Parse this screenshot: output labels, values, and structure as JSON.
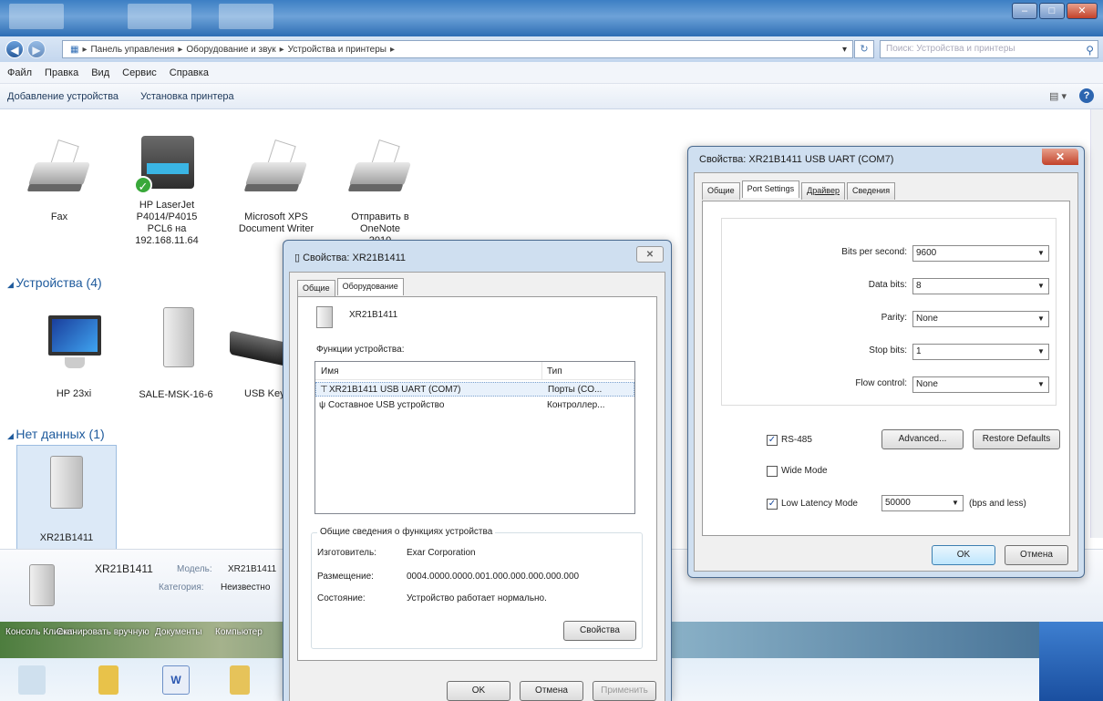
{
  "explorer": {
    "breadcrumbs": [
      "Панель управления",
      "Оборудование и звук",
      "Устройства и принтеры"
    ],
    "search_placeholder": "Поиск: Устройства и принтеры",
    "menu": [
      "Файл",
      "Правка",
      "Вид",
      "Сервис",
      "Справка"
    ],
    "commands": [
      "Добавление устройства",
      "Установка принтера"
    ],
    "printers": [
      {
        "label": "Fax",
        "icon": "fax-icon"
      },
      {
        "label": "HP LaserJet P4014/P4015 PCL6 на 192.168.11.64",
        "icon": "hp-laserjet-printer-icon"
      },
      {
        "label": "Microsoft XPS Document Writer",
        "icon": "xps-printer-icon"
      },
      {
        "label": "Отправить в OneNote 2010",
        "icon": "onenote-printer-icon"
      }
    ],
    "group_devices": "Устройства (4)",
    "devices": [
      {
        "label": "HP 23xi",
        "icon": "monitor-icon"
      },
      {
        "label": "SALE-MSK-16-6",
        "icon": "computer-tower-icon"
      },
      {
        "label": "USB Key",
        "icon": "keyboard-icon"
      }
    ],
    "group_nodata": "Нет данных (1)",
    "nodata_devices": [
      {
        "label": "XR21B1411",
        "icon": "generic-device-icon"
      }
    ],
    "details": {
      "name": "XR21B1411",
      "model_label": "Модель:",
      "model_value": "XR21B1411",
      "category_label": "Категория:",
      "category_value": "Неизвестно"
    },
    "desktop_labels": [
      "Консоль Клиент",
      "Сканировать вручную",
      "Документы",
      "Компьютер"
    ]
  },
  "props_dialog": {
    "title": "Свойства: XR21B1411",
    "close": "✕",
    "tabs": [
      "Общие",
      "Оборудование"
    ],
    "device_name": "XR21B1411",
    "functions_label": "Функции устройства:",
    "col_name": "Имя",
    "col_type": "Тип",
    "rows": [
      {
        "name": "XR21B1411 USB UART (COM7)",
        "type": "Порты (CO..."
      },
      {
        "name": "Составное USB устройство",
        "type": "Контроллер..."
      }
    ],
    "summary_legend": "Общие сведения о функциях устройства",
    "manufacturer_label": "Изготовитель:",
    "manufacturer_value": "Exar Corporation",
    "location_label": "Размещение:",
    "location_value": "0004.0000.0000.001.000.000.000.000.000",
    "status_label": "Состояние:",
    "status_value": "Устройство работает нормально.",
    "properties_button": "Свойства",
    "ok": "OK",
    "cancel": "Отмена",
    "apply": "Применить"
  },
  "port_dialog": {
    "title": "Свойства: XR21B1411 USB UART (COM7)",
    "close": "✕",
    "tabs": [
      "Общие",
      "Port Settings",
      "Драйвер",
      "Сведения"
    ],
    "bits_label": "Bits per second:",
    "bits_value": "9600",
    "data_label": "Data bits:",
    "data_value": "8",
    "parity_label": "Parity:",
    "parity_value": "None",
    "stop_label": "Stop bits:",
    "stop_value": "1",
    "flow_label": "Flow control:",
    "flow_value": "None",
    "rs485_label": "RS-485",
    "rs485_checked": true,
    "advanced_button": "Advanced...",
    "restore_button": "Restore Defaults",
    "wide_label": "Wide Mode",
    "wide_checked": false,
    "latency_label": "Low Latency Mode",
    "latency_checked": true,
    "latency_value": "50000",
    "latency_unit": "(bps and less)",
    "ok": "OK",
    "cancel": "Отмена"
  }
}
